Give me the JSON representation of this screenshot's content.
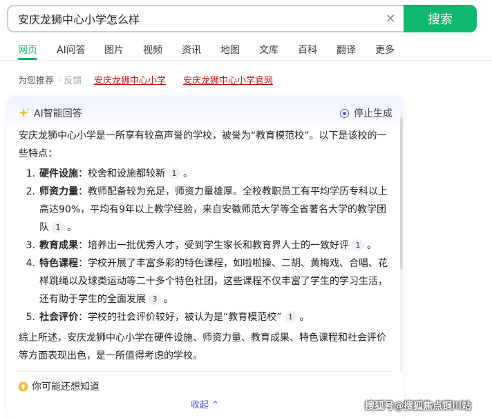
{
  "search": {
    "query": "安庆龙狮中心小学怎么样",
    "button_label": "搜索"
  },
  "tabs": [
    {
      "label": "网页",
      "active": true
    },
    {
      "label": "AI问答"
    },
    {
      "label": "图片"
    },
    {
      "label": "视频"
    },
    {
      "label": "资讯"
    },
    {
      "label": "地图"
    },
    {
      "label": "文库"
    },
    {
      "label": "百科"
    },
    {
      "label": "翻译"
    },
    {
      "label": "更多"
    }
  ],
  "recommend": {
    "label": "为您推荐",
    "feedback": "· 反馈",
    "links": [
      "安庆龙狮中心小学",
      "安庆龙狮中心小学官网"
    ]
  },
  "ai_answer": {
    "title": "AI智能回答",
    "stop_label": "停止生成",
    "intro": "安庆龙狮中心小学是一所享有较高声誉的学校，被誉为“教育模范校”。以下是该校的一些特点：",
    "items": [
      {
        "num": "1.",
        "title": "硬件设施",
        "text": "：校舍和设施都较新",
        "cite": "1",
        "end": "。"
      },
      {
        "num": "2.",
        "title": "师资力量",
        "text": "：教师配备较为充足，师资力量雄厚。全校教职员工有平均学历专科以上高达90%，平均有9年以上教学经验，来自安徽师范大学等全省著名大学的教学团队",
        "cite": "1",
        "end": "。"
      },
      {
        "num": "3.",
        "title": "教育成果",
        "text": "：培养出一批优秀人才，受到学生家长和教育界人士的一致好评",
        "cite": "1",
        "end": "。"
      },
      {
        "num": "4.",
        "title": "特色课程",
        "text": "：学校开展了丰富多彩的特色课程，如啦啦操、二胡、黄梅戏、合唱、花样跳绳以及球类运动等二十多个特色社团，这些课程不仅丰富了学生的学习生活，还有助于学生的全面发展",
        "cite": "3",
        "end": "。"
      },
      {
        "num": "5.",
        "title": "社会评价",
        "text": "：学校的社会评价较好，被认为是“教育模范校”",
        "cite": "1",
        "end": "。"
      }
    ],
    "summary": "综上所述，安庆龙狮中心小学在硬件设施、师资力量、教育成果、特色课程和社会评价等方面表现出色，是一所值得考虑的学校。",
    "maybe_label": "你可能还想知道",
    "collapse_label": "收起 ⌃"
  },
  "watermark": "搜狐号@搜狐焦点铜川站",
  "colors": {
    "brand_green": "#0fb86a",
    "link_red": "#c21010",
    "accent_blue": "#4a5bd6"
  }
}
